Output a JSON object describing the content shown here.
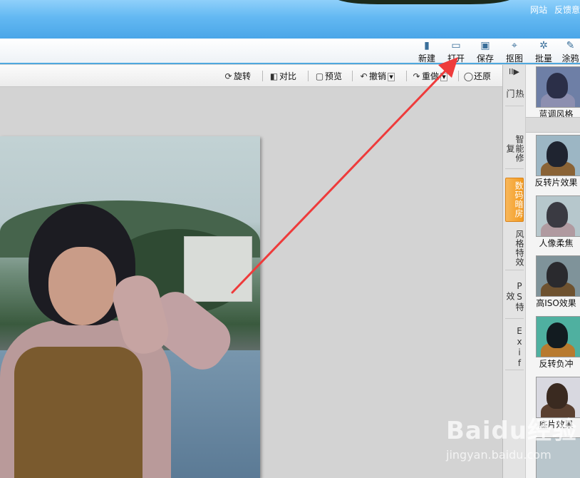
{
  "titlebar": {
    "links": [
      "网站",
      "反馈意"
    ]
  },
  "main_toolbar": [
    {
      "label": "新建",
      "icon": "new-file-icon",
      "glyph": "▮"
    },
    {
      "label": "打开",
      "icon": "open-folder-icon",
      "glyph": "▭"
    },
    {
      "label": "保存",
      "icon": "save-icon",
      "glyph": "▣"
    },
    {
      "label": "抠图",
      "icon": "cutout-icon",
      "glyph": "⌖"
    },
    {
      "label": "批量",
      "icon": "batch-gear-icon",
      "glyph": "✲"
    },
    {
      "label": "涂鸦",
      "icon": "doodle-icon",
      "glyph": "✎"
    }
  ],
  "sub_toolbar": {
    "rotate": "旋转",
    "compare": "对比",
    "preview": "预览",
    "undo": "撤销",
    "redo": "重做",
    "restore": "还原"
  },
  "vertical_tabs": {
    "collapse_glyph": "II▶",
    "tabs": [
      {
        "label": "热门",
        "active": false
      },
      {
        "label": "智能修复",
        "active": false
      },
      {
        "label": "数码暗房",
        "active": true
      },
      {
        "label": "风格特效",
        "active": false
      },
      {
        "label": "PS特效",
        "active": false
      },
      {
        "label": "Exif",
        "active": false
      }
    ]
  },
  "effects": [
    {
      "name": "蓝调风格",
      "tint": "#6e7fa6",
      "face": "#2b2f48",
      "body": "#8d8fb0"
    },
    {
      "name": "反转片效果",
      "tint": "#9cb6c4",
      "face": "#1f2430",
      "body": "#8a6336"
    },
    {
      "name": "人像柔焦",
      "tint": "#b6c7cc",
      "face": "#3a3a42",
      "body": "#b09aa0"
    },
    {
      "name": "高ISO效果",
      "tint": "#7f939a",
      "face": "#2a2a2e",
      "body": "#6e5230"
    },
    {
      "name": "反转负冲",
      "tint": "#4fb0a0",
      "face": "#121b20",
      "body": "#b87a2f"
    },
    {
      "name": "底片效果",
      "tint": "#d8d8e0",
      "face": "#3a2a20",
      "body": "#5a4030"
    }
  ],
  "watermark": {
    "text": "Baidu经验",
    "url": "jingyan.baidu.com"
  },
  "colors": {
    "titlebar": "#5eb4ef",
    "accent_tab": "#f39a1e",
    "arrow": "#ee3b3b"
  }
}
